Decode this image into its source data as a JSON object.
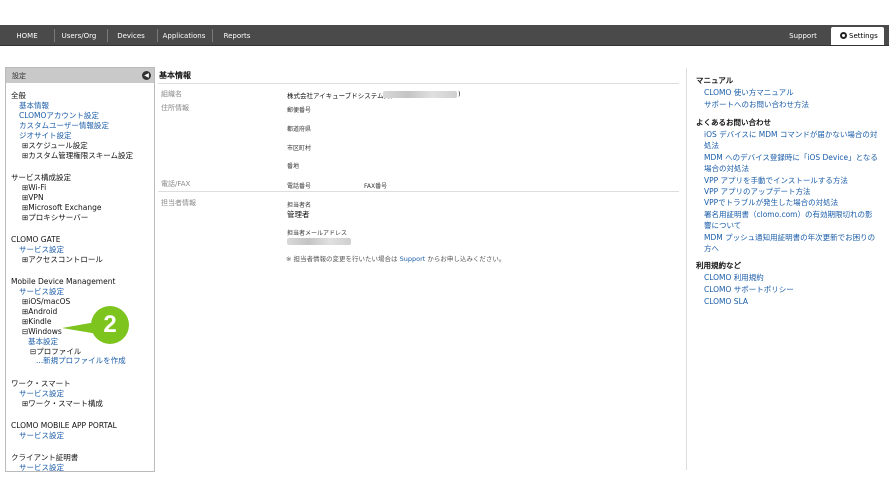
{
  "nav": {
    "items": [
      "HOME",
      "Users/Org",
      "Devices",
      "Applications",
      "Reports"
    ],
    "support": "Support",
    "settings": "Settings"
  },
  "sidebar": {
    "header": "設定",
    "collapse_glyph": "◀",
    "sections": [
      {
        "title": "全般",
        "links": [
          "基本情報",
          "CLOMOアカウント設定",
          "カスタムユーザー情報設定",
          "ジオサイト設定"
        ],
        "items": [
          "⊞スケジュール設定",
          "⊞カスタム管理権限スキーム設定"
        ]
      },
      {
        "title": "サービス構成設定",
        "items": [
          "⊞Wi-Fi",
          "⊞VPN",
          "⊞Microsoft Exchange",
          "⊞プロキシサーバー"
        ]
      },
      {
        "title": "CLOMO GATE",
        "links": [
          "サービス設定"
        ],
        "items": [
          "⊞アクセスコントロール"
        ]
      },
      {
        "title": "Mobile Device Management",
        "links": [
          "サービス設定"
        ],
        "items": [
          "⊞iOS/macOS",
          "⊞Android",
          "⊞Kindle",
          "⊟Windows"
        ],
        "windows_children": {
          "link": "基本設定",
          "item": "⊟プロファイル",
          "new_link": "...新規プロファイルを作成"
        }
      },
      {
        "title": "ワーク・スマート",
        "links": [
          "サービス設定"
        ],
        "items": [
          "⊞ワーク・スマート構成"
        ]
      },
      {
        "title": "CLOMO MOBILE APP PORTAL",
        "links": [
          "サービス設定"
        ]
      },
      {
        "title": "クライアント証明書",
        "links": [
          "サービス設定"
        ]
      }
    ]
  },
  "main": {
    "title": "基本情報",
    "org_label": "組織名",
    "org_value": "株式会社アイキューブドシステムズ(",
    "org_value_end": ")",
    "address_label": "住所情報",
    "address_fields": [
      "郵便番号",
      "都道府県",
      "市区町村",
      "番地"
    ],
    "phone_label": "電話/FAX",
    "phone_field": "電話番号",
    "fax_field": "FAX番号",
    "contact_label": "担当者情報",
    "contact_name_field": "担当者名",
    "contact_name_value": "管理者",
    "contact_email_field": "担当者メールアドレス",
    "note_prefix": "※ 担当者情報の変更を行いたい場合は ",
    "note_link": "Support",
    "note_suffix": " からお申し込みください。"
  },
  "right": {
    "manual_head": "マニュアル",
    "manual_links": [
      "CLOMO 使い方マニュアル",
      "サポートへのお問い合わせ方法"
    ],
    "faq_head": "よくあるお問い合わせ",
    "faq_links": [
      "iOS デバイスに MDM コマンドが届かない場合の対処法",
      "MDM へのデバイス登録時に「iOS Device」となる場合の対処法",
      "VPP アプリを手動でインストールする方法",
      "VPP アプリのアップデート方法",
      "VPPでトラブルが発生した場合の対処法",
      "署名用証明書（clomo.com）の有効期限切れの影響について",
      "MDM プッシュ通知用証明書の年次更新でお困りの方へ"
    ],
    "terms_head": "利用規約など",
    "terms_links": [
      "CLOMO 利用規約",
      "CLOMO サポートポリシー",
      "CLOMO SLA"
    ]
  },
  "callout": {
    "number": "2"
  },
  "colors": {
    "topbar": "#4a4a4a",
    "link": "#1a5ca8",
    "callout": "#7dc41f"
  }
}
